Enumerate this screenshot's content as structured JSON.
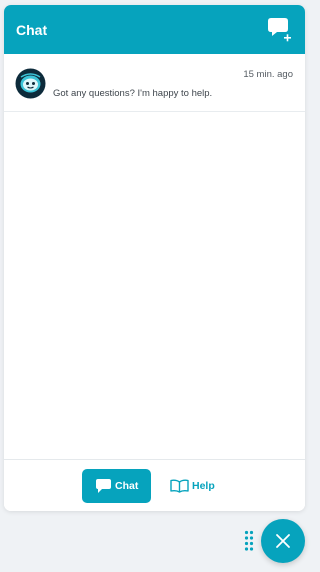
{
  "header": {
    "title": "Chat",
    "new_chat_icon": "chat-bubble-plus-icon"
  },
  "conversation": {
    "avatar_icon": "agent-avatar",
    "time": "15 min. ago",
    "message": "Got any questions? I'm happy to help."
  },
  "footer": {
    "tabs": [
      {
        "label": "Chat",
        "icon": "chat-bubble-icon",
        "active": true
      },
      {
        "label": "Help",
        "icon": "book-icon",
        "active": false
      }
    ]
  },
  "launcher": {
    "drag_icon": "drag-handle-icon",
    "close_icon": "close-icon"
  },
  "colors": {
    "accent": "#06a3bd",
    "background": "#eff2f5",
    "panel": "#ffffff"
  }
}
